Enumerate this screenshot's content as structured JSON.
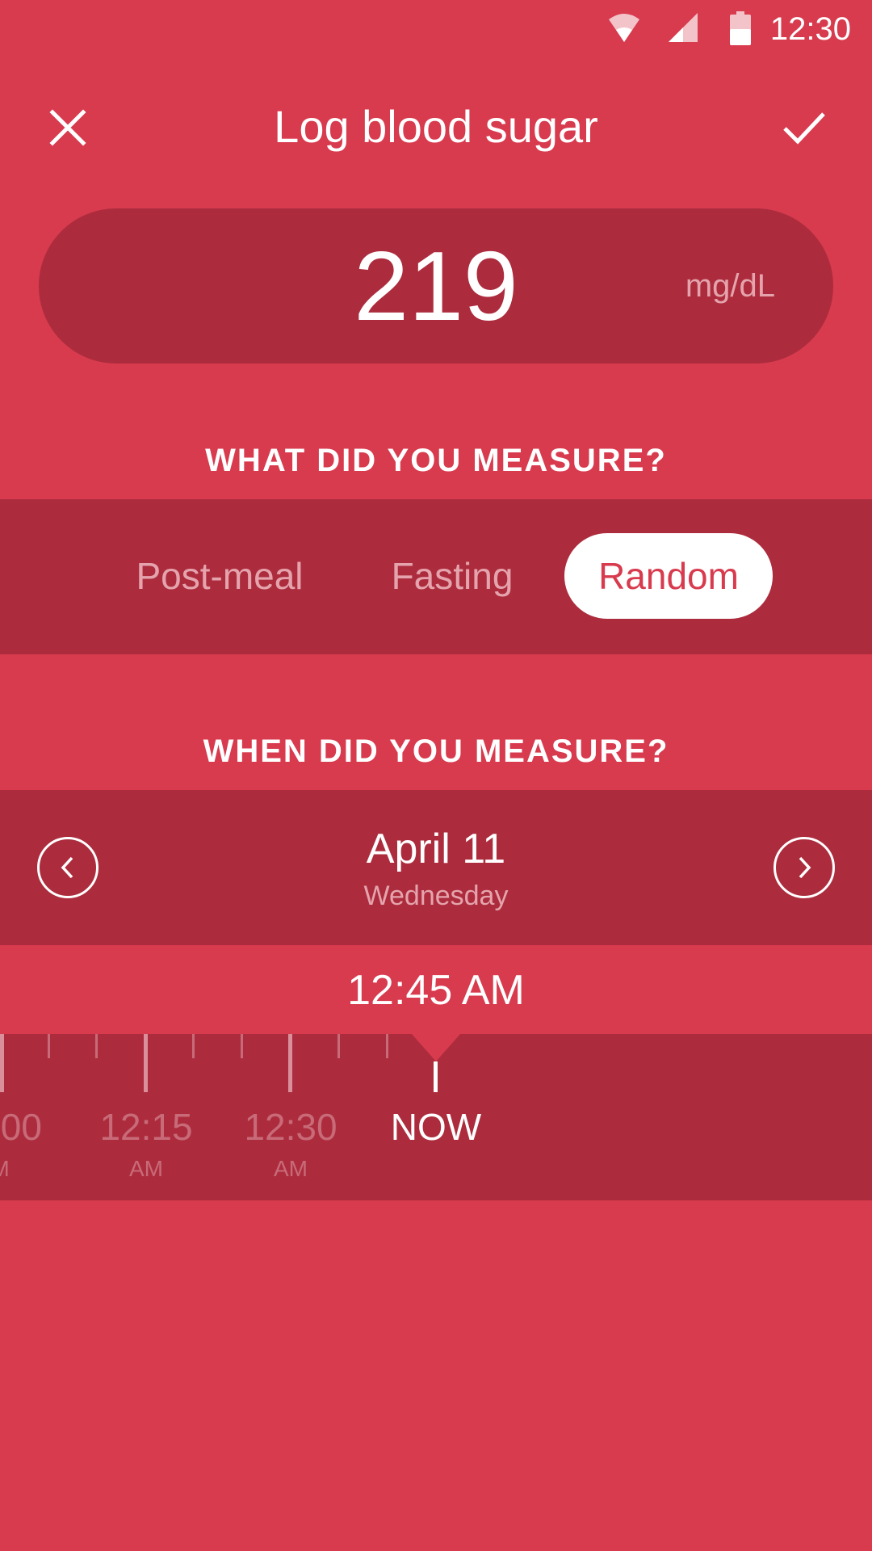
{
  "status_bar": {
    "time": "12:30",
    "icons": [
      "wifi-icon",
      "signal-icon",
      "battery-icon"
    ]
  },
  "app_bar": {
    "title": "Log blood sugar",
    "close_icon": "close-icon",
    "confirm_icon": "check-icon"
  },
  "reading": {
    "value": "219",
    "unit": "mg/dL"
  },
  "measure_type": {
    "heading": "WHAT DID YOU MEASURE?",
    "options": [
      "Post-meal",
      "Fasting",
      "Random"
    ],
    "selected": "Random"
  },
  "measure_time": {
    "heading": "WHEN DID YOU MEASURE?",
    "date": "April 11",
    "weekday": "Wednesday",
    "prev_icon": "chevron-left-icon",
    "next_icon": "chevron-right-icon",
    "time": "12:45 AM"
  },
  "timeline": {
    "labels": [
      {
        "time": ":00",
        "period": "M"
      },
      {
        "time": "12:15",
        "period": "AM"
      },
      {
        "time": "12:30",
        "period": "AM"
      },
      {
        "time": "NOW",
        "period": ""
      }
    ]
  },
  "colors": {
    "background": "#d83a4e",
    "band": "#ac2c3d",
    "muted_text": "#e5a4ad",
    "selected_text": "#d83a4e"
  }
}
